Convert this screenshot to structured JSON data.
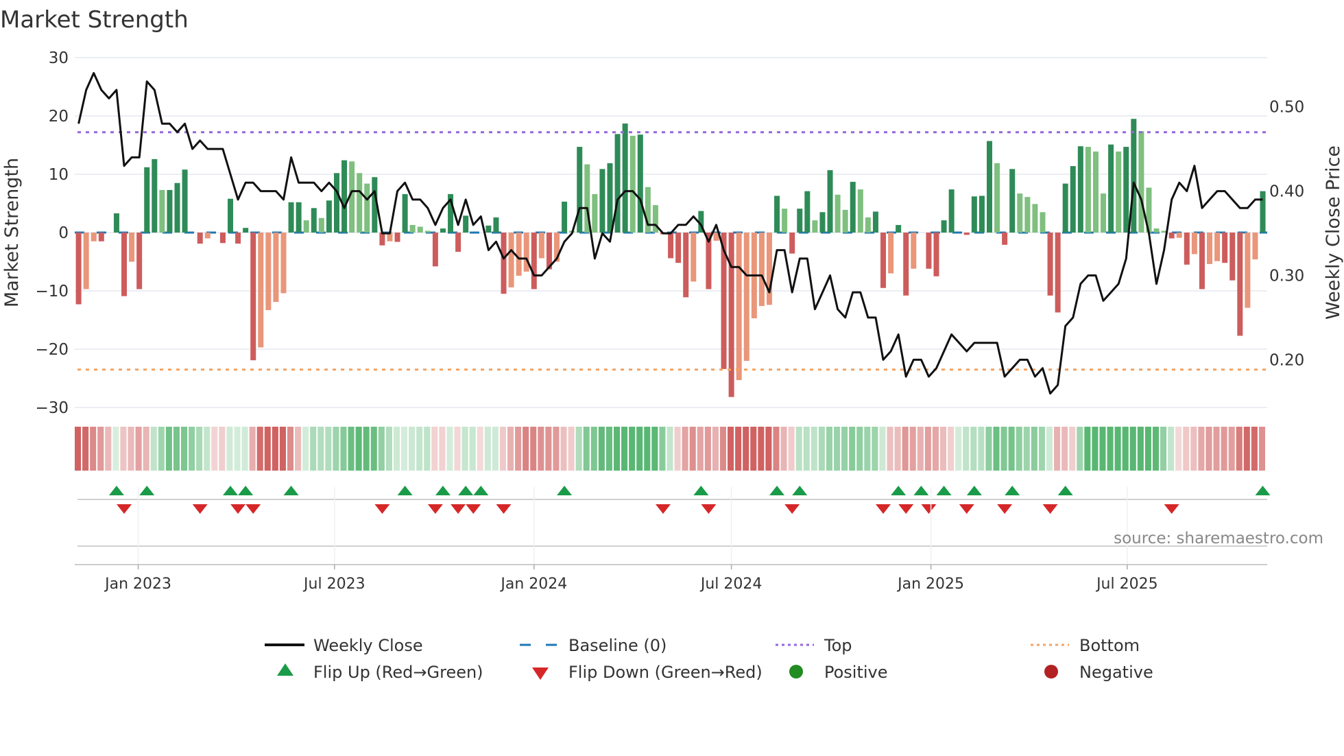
{
  "chart_data": {
    "type": "bar",
    "title": "Market Strength",
    "ylabel": "Market Strength",
    "y2label": "Weekly Close Price",
    "ylim": [
      -30,
      30
    ],
    "y2ticks": [
      "0.20",
      "0.30",
      "0.40",
      "0.50"
    ],
    "y2tick_values": [
      0.2,
      0.3,
      0.4,
      0.5
    ],
    "yticks": [
      "30",
      "20",
      "10",
      "0",
      "−10",
      "−20",
      "−30"
    ],
    "ytick_values": [
      30,
      20,
      10,
      0,
      -10,
      -20,
      -30
    ],
    "xticks": [
      "Jan 2023",
      "Jul 2023",
      "Jan 2024",
      "Jul 2024",
      "Jan 2025",
      "Jul 2025"
    ],
    "xtick_dates": [
      "2023-01-01",
      "2023-07-01",
      "2024-01-01",
      "2024-07-01",
      "2025-01-01",
      "2025-07-01"
    ],
    "first_week": "2022-11-07",
    "interval_days": 7,
    "top_level": 17.2,
    "bottom_level": -23.5,
    "strength": [
      -12.3,
      -9.7,
      -1.5,
      -1.5,
      0,
      3.3,
      -10.9,
      -5.0,
      -9.7,
      11.2,
      12.6,
      7.3,
      7.3,
      8.5,
      10.8,
      0,
      -1.9,
      -1.0,
      0,
      -1.8,
      5.8,
      -1.9,
      0.8,
      -21.9,
      -19.7,
      -13.3,
      -11.9,
      -10.4,
      5.2,
      5.2,
      2.1,
      4.2,
      2.5,
      5.5,
      10.2,
      12.4,
      12.2,
      10.2,
      8.4,
      9.5,
      -2.2,
      -1.5,
      -1.6,
      6.6,
      1.3,
      1.0,
      0.3,
      -5.8,
      0.7,
      6.6,
      -3.3,
      2.9,
      0,
      0,
      1.2,
      2.6,
      -10.5,
      -9.4,
      -7.4,
      -6.7,
      -9.7,
      -4.4,
      -6.3,
      -5.0,
      5.3,
      0.3,
      14.7,
      11.7,
      6.6,
      10.9,
      11.9,
      16.9,
      18.7,
      16.6,
      16.8,
      7.8,
      4.7,
      -0.3,
      -4.4,
      -5.2,
      -11.1,
      -8.4,
      3.7,
      -9.7,
      -1.4,
      -23.4,
      -28.2,
      -25.3,
      -22.0,
      -14.7,
      -12.6,
      -12.4,
      6.3,
      4.1,
      -3.6,
      4.1,
      7.1,
      2.1,
      3.5,
      10.7,
      6.5,
      3.9,
      8.7,
      7.4,
      2.6,
      3.6,
      -9.5,
      -7.0,
      1.3,
      -10.8,
      -6.2,
      0,
      -6.2,
      -7.5,
      2.1,
      7.4,
      0,
      -0.4,
      6.2,
      6.3,
      15.7,
      11.9,
      -2.1,
      10.9,
      6.7,
      6.1,
      4.9,
      3.5,
      -10.8,
      -13.7,
      8.4,
      11.4,
      14.8,
      14.7,
      13.9,
      6.7,
      15.1,
      13.9,
      14.7,
      19.5,
      17.4,
      7.7,
      0.7,
      0.3,
      -1.0,
      -0.9,
      -5.5,
      -3.7,
      -9.7,
      -5.4,
      -4.9,
      -5.2,
      -8.2,
      -17.7,
      -12.9,
      -4.6,
      7.1
    ],
    "weekly_close": [
      0.48,
      0.52,
      0.54,
      0.52,
      0.51,
      0.52,
      0.43,
      0.44,
      0.44,
      0.53,
      0.52,
      0.48,
      0.48,
      0.47,
      0.48,
      0.45,
      0.46,
      0.45,
      0.45,
      0.45,
      0.42,
      0.39,
      0.41,
      0.41,
      0.4,
      0.4,
      0.4,
      0.39,
      0.44,
      0.41,
      0.41,
      0.41,
      0.4,
      0.41,
      0.4,
      0.38,
      0.4,
      0.4,
      0.39,
      0.4,
      0.35,
      0.35,
      0.4,
      0.41,
      0.39,
      0.39,
      0.38,
      0.36,
      0.38,
      0.39,
      0.36,
      0.39,
      0.36,
      0.37,
      0.33,
      0.34,
      0.32,
      0.33,
      0.32,
      0.32,
      0.3,
      0.3,
      0.31,
      0.32,
      0.34,
      0.35,
      0.38,
      0.38,
      0.32,
      0.35,
      0.34,
      0.39,
      0.4,
      0.4,
      0.39,
      0.36,
      0.36,
      0.35,
      0.35,
      0.36,
      0.36,
      0.37,
      0.36,
      0.34,
      0.36,
      0.33,
      0.31,
      0.31,
      0.3,
      0.3,
      0.3,
      0.28,
      0.33,
      0.33,
      0.28,
      0.32,
      0.32,
      0.26,
      0.28,
      0.3,
      0.26,
      0.25,
      0.28,
      0.28,
      0.25,
      0.25,
      0.2,
      0.21,
      0.23,
      0.18,
      0.2,
      0.2,
      0.18,
      0.19,
      0.21,
      0.23,
      0.22,
      0.21,
      0.22,
      0.22,
      0.22,
      0.22,
      0.18,
      0.19,
      0.2,
      0.2,
      0.18,
      0.19,
      0.16,
      0.17,
      0.24,
      0.25,
      0.29,
      0.3,
      0.3,
      0.27,
      0.28,
      0.29,
      0.32,
      0.41,
      0.39,
      0.35,
      0.29,
      0.33,
      0.39,
      0.41,
      0.4,
      0.43,
      0.38,
      0.39,
      0.4,
      0.4,
      0.39,
      0.38,
      0.38,
      0.39,
      0.39
    ],
    "price_range": [
      0.115,
      0.5586
    ],
    "flip_up_weeks": [
      5,
      9,
      20,
      22,
      28,
      43,
      48,
      51,
      53,
      64,
      82,
      92,
      95,
      108,
      111,
      114,
      118,
      123,
      130,
      156
    ],
    "flip_down_weeks": [
      6,
      16,
      21,
      23,
      40,
      47,
      50,
      52,
      56,
      77,
      83,
      94,
      106,
      109,
      112,
      117,
      122,
      128,
      144
    ],
    "legend": [
      {
        "key": "weekly_close",
        "label": "Weekly Close"
      },
      {
        "key": "baseline",
        "label": "Baseline (0)"
      },
      {
        "key": "top",
        "label": "Top"
      },
      {
        "key": "bottom",
        "label": "Bottom"
      },
      {
        "key": "flip_up",
        "label": "Flip Up (Red→Green)"
      },
      {
        "key": "flip_down",
        "label": "Flip Down (Green→Red)"
      },
      {
        "key": "positive",
        "label": "Positive"
      },
      {
        "key": "negative",
        "label": "Negative"
      }
    ],
    "legend_placement": "bottom",
    "grid": true,
    "source": "source: sharemaestro.com",
    "colors": {
      "up_strong": "#2e8b57",
      "up_weak": "#7fbf7f",
      "down_strong": "#cd5c5c",
      "down_weak": "#e9967a",
      "line": "#111111",
      "baseline": "#1f77b4",
      "top": "#9467dd",
      "bottom": "#f4a261",
      "flip_up": "#1a9b48",
      "flip_down": "#d62728",
      "positive": "#228b22",
      "negative": "#b22222"
    }
  }
}
